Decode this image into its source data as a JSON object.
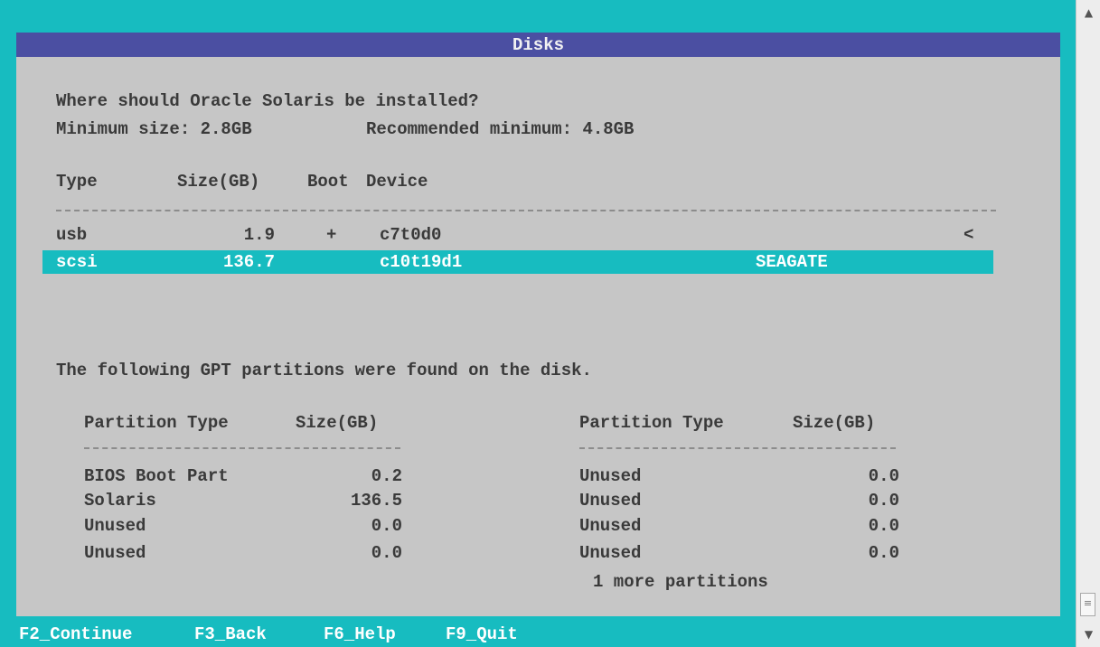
{
  "window": {
    "title": "Disks"
  },
  "prompt": {
    "question": "Where should Oracle Solaris be installed?",
    "minimum": "Minimum size: 2.8GB",
    "recommended": "Recommended minimum: 4.8GB"
  },
  "disks": {
    "headers": {
      "type": "Type",
      "size": "Size(GB)",
      "boot": "Boot",
      "device": "Device"
    },
    "rows": [
      {
        "type": "usb",
        "size": "1.9",
        "boot": "+",
        "device": "c7t0d0",
        "vendor": "",
        "marker": "<",
        "selected": false
      },
      {
        "type": "scsi",
        "size": "136.7",
        "boot": "",
        "device": "c10t19d1",
        "vendor": "SEAGATE",
        "marker": "",
        "selected": true
      }
    ]
  },
  "partitions": {
    "message": "The following GPT partitions were found on the disk.",
    "headers": {
      "type": "Partition Type",
      "size": "Size(GB)"
    },
    "left": [
      {
        "type": "BIOS Boot Part",
        "size": "0.2"
      },
      {
        "type": "Solaris",
        "size": "136.5"
      },
      {
        "type": "Unused",
        "size": "0.0"
      },
      {
        "type": "Unused",
        "size": "0.0"
      }
    ],
    "right": [
      {
        "type": "Unused",
        "size": "0.0"
      },
      {
        "type": "Unused",
        "size": "0.0"
      },
      {
        "type": "Unused",
        "size": "0.0"
      },
      {
        "type": "Unused",
        "size": "0.0"
      }
    ],
    "more": "1 more partitions"
  },
  "function_keys": [
    {
      "label": "F2_Continue"
    },
    {
      "label": "F3_Back"
    },
    {
      "label": "F6_Help"
    },
    {
      "label": "F9_Quit"
    }
  ],
  "scrollbar": {
    "up_icon": "chevron-up-icon",
    "down_icon": "chevron-down-icon",
    "grip_icon": "grip-lines-icon"
  },
  "colors": {
    "background": "#17bcc0",
    "panel": "#c6c6c6",
    "titlebar": "#4b4fa2",
    "selection": "#17bcc0",
    "text": "#3a3a3a"
  }
}
